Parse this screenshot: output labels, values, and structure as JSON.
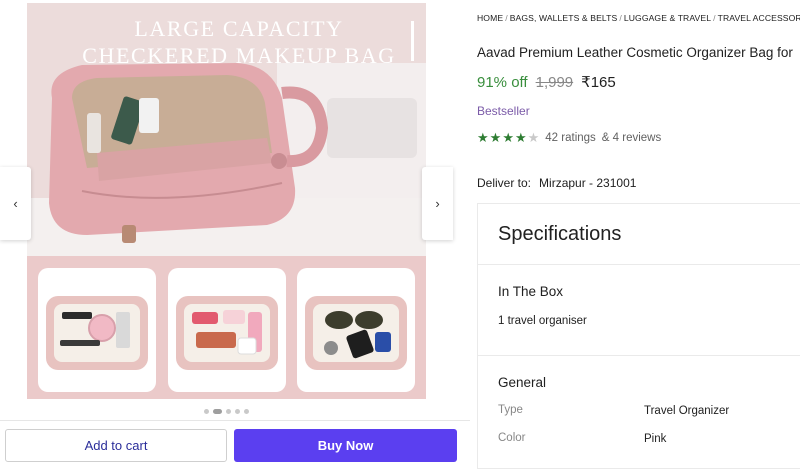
{
  "gallery": {
    "hero_title_line1": "LARGE CAPACITY",
    "hero_title_line2": "CHECKERED MAKEUP BAG",
    "prev_icon": "chevron-left-icon",
    "next_icon": "chevron-right-icon",
    "prev_glyph": "‹",
    "next_glyph": "›",
    "active_slide": 2,
    "slide_count": 5
  },
  "actions": {
    "add_to_cart": "Add to cart",
    "buy_now": "Buy Now"
  },
  "product": {
    "breadcrumb": [
      "HOME",
      "BAGS, WALLETS & BELTS",
      "LUGGAGE & TRAVEL",
      "TRAVEL ACCESSORIES"
    ],
    "title": "Aavad Premium Leather Cosmetic Organizer Bag for",
    "discount": "91% off",
    "mrp": "1,999",
    "price": "₹165",
    "badge": "Bestseller",
    "rating_value": 4,
    "rating_max": 5,
    "ratings_text": "42 ratings",
    "reviews_text": "& 4 reviews",
    "deliver_label": "Deliver to:",
    "deliver_location": "Mirzapur - 231001"
  },
  "specifications": {
    "heading": "Specifications",
    "in_the_box_title": "In The Box",
    "in_the_box_value": "1 travel organiser",
    "general_title": "General",
    "rows": [
      {
        "key": "Type",
        "value": "Travel Organizer"
      },
      {
        "key": "Color",
        "value": "Pink"
      }
    ]
  },
  "colors": {
    "accent": "#5b3ff0",
    "discount": "#388e3c",
    "stars": "#2e7d32",
    "badge": "#7b5ba8",
    "thumb_band": "#ebcaca"
  }
}
